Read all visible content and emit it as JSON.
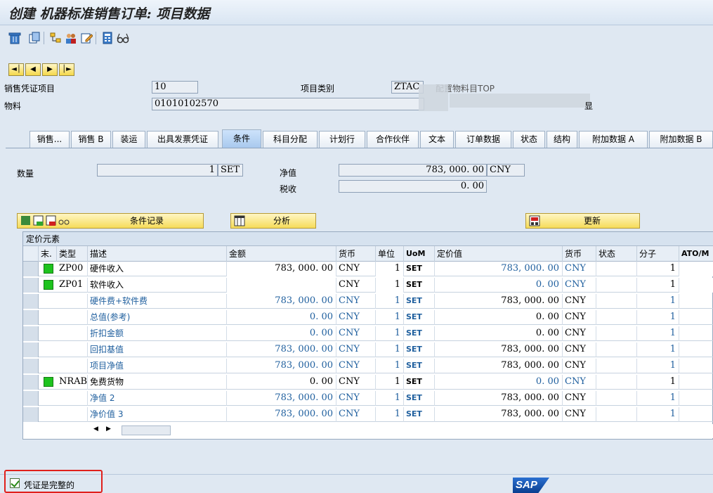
{
  "window": {
    "title": "创建 机器标准销售订单: 项目数据"
  },
  "toolbar": {
    "icons": [
      "delete-icon",
      "copy-icon",
      "tree-icon",
      "people-icon",
      "edit-icon",
      "calculator-icon",
      "glasses-icon"
    ]
  },
  "nav_buttons": [
    "first-item",
    "previous-item",
    "next-item",
    "last-item"
  ],
  "header": {
    "item_label": "销售凭证项目",
    "item_value": "10",
    "item_category_label": "项目类别",
    "item_category_value": "ZTAC",
    "item_category_desc": "配置物料目TOP",
    "material_label": "物料",
    "material_value": "01010102570",
    "material_desc": "显"
  },
  "tabs": [
    "销售...",
    "销售 B",
    "装运",
    "出具发票凭证",
    "条件",
    "科目分配",
    "计划行",
    "合作伙伴",
    "文本",
    "订单数据",
    "状态",
    "结构",
    "附加数据 A",
    "附加数据 B"
  ],
  "selected_tab": "条件",
  "conditions": {
    "qty_label": "数量",
    "qty_value": "1",
    "qty_unit": "SET",
    "net_label": "净值",
    "net_value": "783, 000. 00",
    "net_currency": "CNY",
    "tax_label": "税收",
    "tax_value": "0. 00",
    "btn_condition_record": "条件记录",
    "btn_analysis": "分析",
    "btn_update": "更新"
  },
  "grid": {
    "title": "定价元素",
    "columns": [
      "末.",
      "类型",
      "描述",
      "金额",
      "货币",
      "单位",
      "UoM",
      "定价值",
      "货币",
      "状态",
      "分子",
      "ATO/M"
    ],
    "rows": [
      {
        "status": true,
        "type": "ZP00",
        "desc": "硬件收入",
        "amount": "783, 000. 00",
        "cur": "CNY",
        "unit": "1",
        "uom": "SET",
        "pval": "783, 000. 00",
        "pcur": "CNY",
        "num": "1",
        "editable": true,
        "blue": false
      },
      {
        "status": true,
        "type": "ZP01",
        "desc": "软件收入",
        "amount": "",
        "cur": "CNY",
        "unit": "1",
        "uom": "SET",
        "pval": "0. 00",
        "pcur": "CNY",
        "num": "1",
        "editable": true,
        "blue": false
      },
      {
        "status": false,
        "type": "",
        "desc": "硬件费+软件费",
        "amount": "783, 000. 00",
        "cur": "CNY",
        "unit": "1",
        "uom": "SET",
        "pval": "783, 000. 00",
        "pcur": "CNY",
        "num": "1",
        "editable": false,
        "blue": true
      },
      {
        "status": false,
        "type": "",
        "desc": "总值(参考)",
        "amount": "0. 00",
        "cur": "CNY",
        "unit": "1",
        "uom": "SET",
        "pval": "0. 00",
        "pcur": "CNY",
        "num": "1",
        "editable": false,
        "blue": true
      },
      {
        "status": false,
        "type": "",
        "desc": "折扣金额",
        "amount": "0. 00",
        "cur": "CNY",
        "unit": "1",
        "uom": "SET",
        "pval": "0. 00",
        "pcur": "CNY",
        "num": "1",
        "editable": false,
        "blue": true
      },
      {
        "status": false,
        "type": "",
        "desc": "回扣基值",
        "amount": "783, 000. 00",
        "cur": "CNY",
        "unit": "1",
        "uom": "SET",
        "pval": "783, 000. 00",
        "pcur": "CNY",
        "num": "1",
        "editable": false,
        "blue": true
      },
      {
        "status": false,
        "type": "",
        "desc": "项目净值",
        "amount": "783, 000. 00",
        "cur": "CNY",
        "unit": "1",
        "uom": "SET",
        "pval": "783, 000. 00",
        "pcur": "CNY",
        "num": "1",
        "editable": false,
        "blue": true
      },
      {
        "status": true,
        "type": "NRAB",
        "desc": "免费货物",
        "amount": "0. 00",
        "cur": "CNY",
        "unit": "1",
        "uom": "SET",
        "pval": "0. 00",
        "pcur": "CNY",
        "num": "1",
        "editable": false,
        "blue": false
      },
      {
        "status": false,
        "type": "",
        "desc": "净值 2",
        "amount": "783, 000. 00",
        "cur": "CNY",
        "unit": "1",
        "uom": "SET",
        "pval": "783, 000. 00",
        "pcur": "CNY",
        "num": "1",
        "editable": false,
        "blue": true
      },
      {
        "status": false,
        "type": "",
        "desc": "净价值 3",
        "amount": "783, 000. 00",
        "cur": "CNY",
        "unit": "1",
        "uom": "SET",
        "pval": "783, 000. 00",
        "pcur": "CNY",
        "num": "1",
        "editable": false,
        "blue": true
      }
    ]
  },
  "statusbar": {
    "complete_label": "凭证是完整的",
    "brand": "SAP"
  },
  "colors": {
    "accent_blue": "#1f5f9e",
    "status_green": "#1ec31e",
    "highlight_red": "#e0201c",
    "button_yellow": "#f6dc5a"
  }
}
